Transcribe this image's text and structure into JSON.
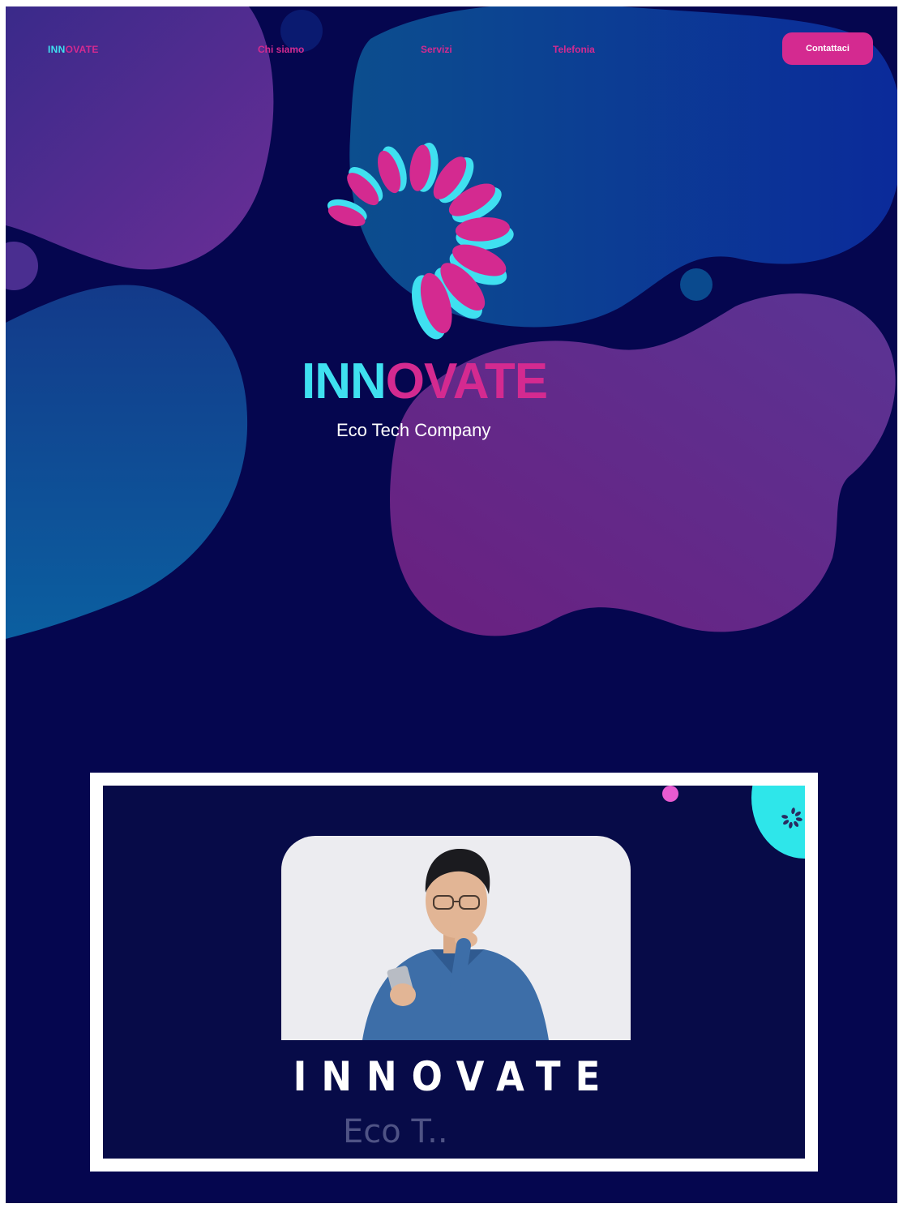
{
  "nav": {
    "logo_part1": "INN",
    "logo_part2": "OVATE",
    "links": [
      "Chi siamo",
      "Servizi",
      "Telefonia"
    ],
    "cta": "Contattaci"
  },
  "hero": {
    "title_part1": "INN",
    "title_part2": "OVATE",
    "subtitle": "Eco Tech Company"
  },
  "video": {
    "title": "INNOVATE",
    "subtitle_partial": "Eco T..",
    "photo_subject": "man-with-phone-thinking"
  },
  "colors": {
    "background": "#05064f",
    "accent_pink": "#d42a90",
    "accent_cyan": "#3fe0f0",
    "blob_purple": "#5b2c8f",
    "blob_blue": "#0a3a8a"
  },
  "icons": [
    "swirl-logo-icon",
    "video-corner-logo-icon"
  ]
}
